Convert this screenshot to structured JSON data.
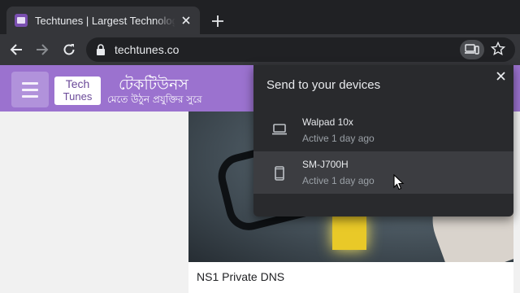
{
  "browser": {
    "tab": {
      "title": "Techtunes | Largest Technology Site",
      "favicon": "techtunes-favicon"
    },
    "address_bar": {
      "url": "techtunes.co",
      "lock_icon": "lock-icon"
    },
    "toolbar_icons": [
      "back-arrow-icon",
      "forward-arrow-icon",
      "reload-icon",
      "send-to-devices-icon",
      "star-icon"
    ]
  },
  "site": {
    "logo_line1": "Tech",
    "logo_line2": "Tunes",
    "brand_name": "টেকটিউনস",
    "tagline": "মেতে উঠুন প্রযুক্তির সুরে",
    "header_color": "#9b72cf",
    "article": {
      "title": "NS1 Private DNS"
    }
  },
  "send_popup": {
    "title": "Send to your devices",
    "devices": [
      {
        "name": "Walpad 10x",
        "status": "Active 1 day ago",
        "icon": "laptop-icon"
      },
      {
        "name": "SM-J700H",
        "status": "Active 1 day ago",
        "icon": "phone-icon"
      }
    ]
  }
}
